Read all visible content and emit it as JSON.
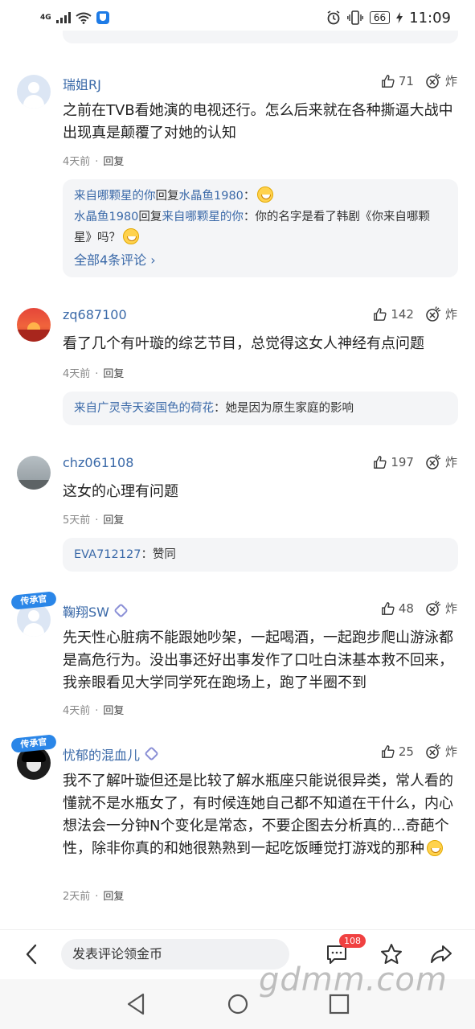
{
  "status": {
    "network": "4G",
    "battery": "66",
    "time": "11:09"
  },
  "comments": [
    {
      "user": "瑞姐RJ",
      "likes": "71",
      "bomb": "炸",
      "text": "之前在TVB看她演的电视还行。怎么后来就在各种撕逼大战中出现真是颠覆了对她的认知",
      "time": "4天前",
      "reply_label": "回复",
      "replies": [
        {
          "from": "来自哪颗星的你",
          "verb": "回复",
          "to": "水晶鱼1980",
          "text": "："
        },
        {
          "from": "水晶鱼1980",
          "verb": "回复",
          "to": "来自哪颗星的你",
          "text": "：你的名字是看了韩剧《你来自哪颗星》吗？"
        }
      ],
      "more": "全部4条评论 ›"
    },
    {
      "user": "zq687100",
      "likes": "142",
      "bomb": "炸",
      "text": "看了几个有叶璇的综艺节目，总觉得这女人神经有点问题",
      "time": "4天前",
      "reply_label": "回复",
      "replies": [
        {
          "from": "来自广灵寺天姿国色的荷花",
          "text": "：她是因为原生家庭的影响"
        }
      ]
    },
    {
      "user": "chz061108",
      "likes": "197",
      "bomb": "炸",
      "text": "这女的心理有问题",
      "time": "5天前",
      "reply_label": "回复",
      "replies": [
        {
          "from": "EVA712127",
          "text": "：赞同"
        }
      ]
    },
    {
      "user": "鞠翔SW",
      "likes": "48",
      "bomb": "炸",
      "text": "先天性心脏病不能跟她吵架，一起喝酒，一起跑步爬山游泳都是高危行为。没出事还好出事发作了口吐白沫基本救不回来，我亲眼看见大学同学死在跑场上，跑了半圈不到",
      "time": "4天前",
      "reply_label": "回复",
      "hat": "传承官"
    },
    {
      "user": "忧郁的混血儿",
      "likes": "25",
      "bomb": "炸",
      "text": "我不了解叶璇但还是比较了解水瓶座只能说很异类，常人看的懂就不是水瓶女了，有时候连她自己都不知道在干什么，内心想法会一分钟N个变化是常态，不要企图去分析真的...奇葩个性，除非你真的和她很熟熟到一起吃饭睡觉打游戏的那种",
      "time": "2天前",
      "reply_label": "回复",
      "hat": "传承官"
    }
  ],
  "bottom": {
    "input_placeholder": "发表评论领金币",
    "comment_count": "108"
  },
  "watermark": "gdmm.com",
  "colors": {
    "link": "#3a69a8",
    "badge": "#f04141",
    "reply_bg": "#f4f5f7"
  }
}
